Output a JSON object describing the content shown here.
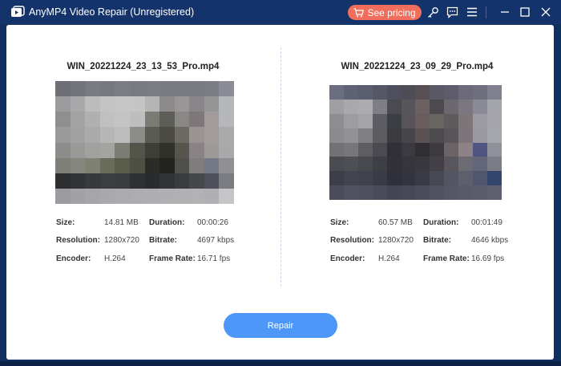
{
  "app": {
    "title": "AnyMP4 Video Repair (Unregistered)"
  },
  "titlebar": {
    "pricing_label": "See pricing",
    "icons": [
      "key-icon",
      "feedback-icon",
      "menu-icon",
      "minimize-icon",
      "maximize-icon",
      "close-icon"
    ]
  },
  "labels": {
    "size": "Size:",
    "resolution": "Resolution:",
    "encoder": "Encoder:",
    "duration": "Duration:",
    "bitrate": "Bitrate:",
    "frame_rate": "Frame Rate:"
  },
  "left_video": {
    "file_name": "WIN_20221224_23_13_53_Pro.mp4",
    "size": "14.81 MB",
    "resolution": "1280x720",
    "encoder": "H.264",
    "duration": "00:00:26",
    "bitrate": "4697 kbps",
    "frame_rate": "16.71 fps"
  },
  "right_video": {
    "file_name": "WIN_20221224_23_09_29_Pro.mp4",
    "size": "60.57 MB",
    "resolution": "1280x720",
    "encoder": "H.264",
    "duration": "00:01:49",
    "bitrate": "4646 kbps",
    "frame_rate": "16.69 fps"
  },
  "repair_label": "Repair",
  "colors": {
    "titlebar": "#13336a",
    "pricing": "#f06e5c",
    "repair": "#4d97f8"
  }
}
